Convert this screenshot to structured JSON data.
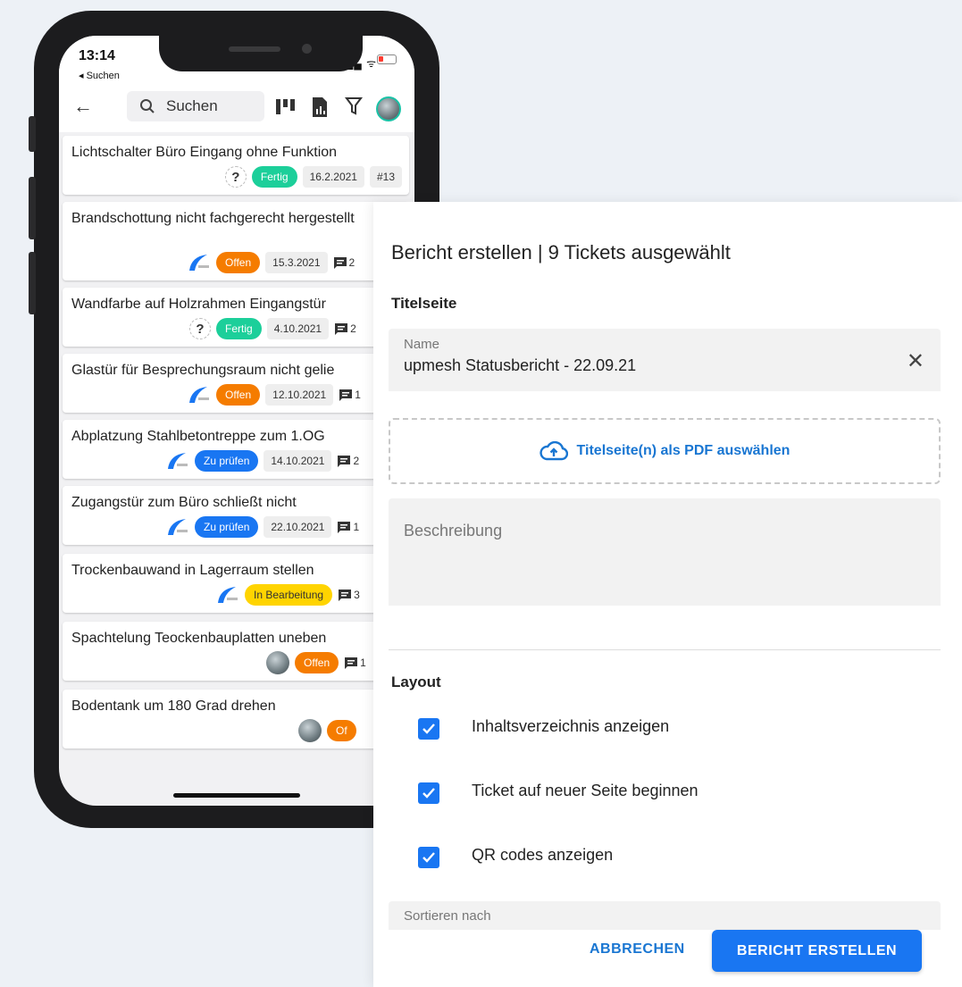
{
  "phone": {
    "time": "13:14",
    "back_app": "◂ Suchen",
    "search_placeholder": "Suchen"
  },
  "tickets": [
    {
      "title": "Lichtschalter Büro Eingang ohne Funktion",
      "status": "Fertig",
      "date": "16.2.2021",
      "number": "#13",
      "comments": ""
    },
    {
      "title": "Brandschottung nicht fachgerecht hergestellt",
      "status": "Offen",
      "date": "15.3.2021",
      "number": "",
      "comments": "2"
    },
    {
      "title": "Wandfarbe auf Holzrahmen Eingangstür",
      "status": "Fertig",
      "date": "4.10.2021",
      "number": "",
      "comments": "2"
    },
    {
      "title": "Glastür für Besprechungsraum nicht gelie",
      "status": "Offen",
      "date": "12.10.2021",
      "number": "",
      "comments": "1"
    },
    {
      "title": "Abplatzung Stahlbetontreppe zum 1.OG",
      "status": "Zu prüfen",
      "date": "14.10.2021",
      "number": "",
      "comments": "2"
    },
    {
      "title": "Zugangstür zum Büro schließt nicht",
      "status": "Zu prüfen",
      "date": "22.10.2021",
      "number": "",
      "comments": "1"
    },
    {
      "title": "Trockenbauwand in Lagerraum stellen",
      "status": "In Bearbeitung",
      "date": "",
      "number": "",
      "comments": "3"
    },
    {
      "title": "Spachtelung Teockenbauplatten uneben",
      "status": "Offen",
      "date": "",
      "number": "",
      "comments": "1"
    },
    {
      "title": "Bodentank um 180 Grad drehen",
      "status": "Of",
      "date": "",
      "number": "",
      "comments": ""
    }
  ],
  "fab_label": "+",
  "dialog": {
    "title": "Bericht erstellen | 9 Tickets ausgewählt",
    "titlepage_section": "Titelseite",
    "name_label": "Name",
    "name_value": "upmesh Statusbericht - 22.09.21",
    "clear_symbol": "✕",
    "upload_label": "Titelseite(n) als PDF auswählen",
    "description_placeholder": "Beschreibung",
    "layout_section": "Layout",
    "options": [
      {
        "label": "Inhaltsverzeichnis anzeigen",
        "checked": true
      },
      {
        "label": "Ticket auf neuer Seite beginnen",
        "checked": true
      },
      {
        "label": "QR codes anzeigen",
        "checked": true
      }
    ],
    "sort_label": "Sortieren nach",
    "cancel_label": "ABBRECHEN",
    "submit_label": "BERICHT ERSTELLEN"
  },
  "colors": {
    "primary": "#1976f2",
    "done": "#1ccf9a",
    "open": "#f57c00",
    "in_progress": "#ffd400"
  }
}
